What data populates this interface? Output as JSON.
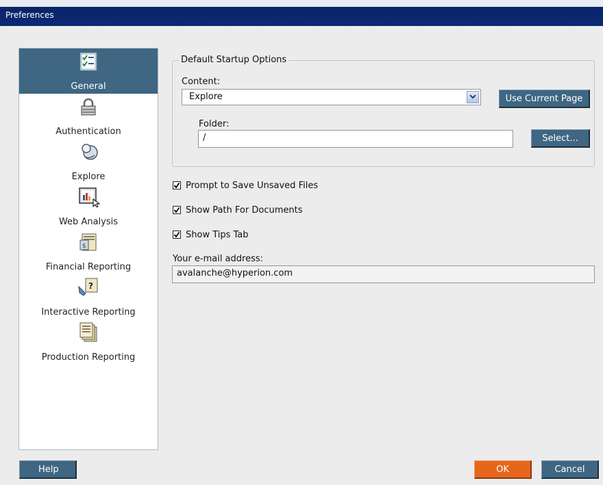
{
  "window": {
    "title": "Preferences"
  },
  "nav": {
    "items": [
      {
        "label": "General",
        "icon": "checklist-icon",
        "selected": true
      },
      {
        "label": "Authentication",
        "icon": "lock-icon",
        "selected": false
      },
      {
        "label": "Explore",
        "icon": "explore-icon",
        "selected": false
      },
      {
        "label": "Web Analysis",
        "icon": "chart-cursor-icon",
        "selected": false
      },
      {
        "label": "Financial Reporting",
        "icon": "financial-report-icon",
        "selected": false
      },
      {
        "label": "Interactive Reporting",
        "icon": "interactive-report-icon",
        "selected": false
      },
      {
        "label": "Production Reporting",
        "icon": "production-report-icon",
        "selected": false
      }
    ]
  },
  "startup": {
    "legend": "Default Startup Options",
    "content_label": "Content:",
    "content_value": "Explore",
    "use_current_page": "Use Current Page",
    "folder_label": "Folder:",
    "folder_value": "/",
    "select_button": "Select..."
  },
  "options": [
    {
      "label": "Prompt to Save Unsaved Files",
      "checked": true
    },
    {
      "label": "Show Path For Documents",
      "checked": true
    },
    {
      "label": "Show Tips Tab",
      "checked": true
    }
  ],
  "email": {
    "label": "Your e-mail address:",
    "value": "avalanche@hyperion.com"
  },
  "footer": {
    "help": "Help",
    "ok": "OK",
    "cancel": "Cancel"
  },
  "colors": {
    "titlebar": "#0b2a74",
    "accent": "#3f6682",
    "ok": "#e6661c"
  }
}
